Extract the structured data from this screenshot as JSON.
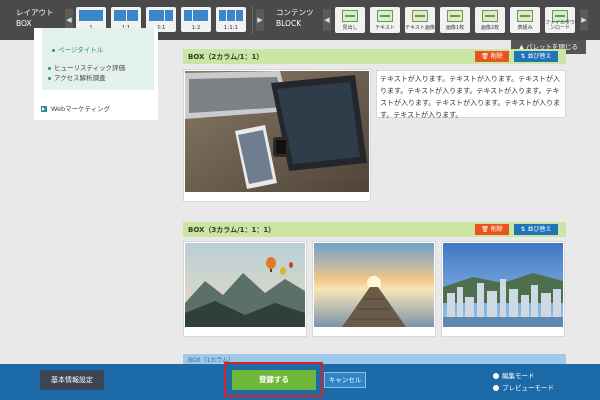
{
  "toolbar": {
    "layout_title": "レイアウト",
    "layout_sub": "BOX",
    "layout_buttons": [
      "1",
      "1:1",
      "2:1",
      "1:2",
      "1:1:1"
    ],
    "content_title": "コンテンツ",
    "content_sub": "BLOCK",
    "content_buttons": [
      "見出し",
      "テキスト",
      "テキスト画像",
      "画像1枚",
      "画像2枚",
      "表組み",
      "ファイルダウンロード"
    ],
    "arrow_left": "◀",
    "arrow_right": "▶"
  },
  "palette_close": "▲ パレットを閉じる",
  "sidebar": {
    "items": [
      "ページタイトル",
      "ヒューリスティック評価",
      "アクセス解析調査",
      "Webマーケティング"
    ]
  },
  "box2": {
    "title": "BOX（2カラム/1：1）",
    "delete": "削除",
    "sort": "並び替え",
    "text": "テキストが入ります。テキストが入ります。テキストが入ります。テキストが入ります。テキストが入ります。テキストが入ります。テキストが入ります。テキストが入ります。テキストが入ります。"
  },
  "box3": {
    "title": "BOX（3カラム/1：1：1）",
    "delete": "削除",
    "sort": "並び替え"
  },
  "next_box_title": "BOX（1カラム）",
  "footer": {
    "basic_settings": "基本情報設定",
    "save": "登録する",
    "cancel": "キャンセル",
    "edit_mode": "編集モード",
    "preview_mode": "プレビューモード"
  },
  "colors": {
    "toolbar_bg": "#4a4a4a",
    "header_green": "#cbe5a4",
    "delete_orange": "#e9561b",
    "sort_blue": "#1f74b8",
    "footer_blue": "#1d6aa8",
    "save_green": "#6fb83a",
    "highlight_red": "#e02020"
  },
  "icons": {
    "trash": "trash-icon",
    "sort": "sort-arrows-icon"
  }
}
